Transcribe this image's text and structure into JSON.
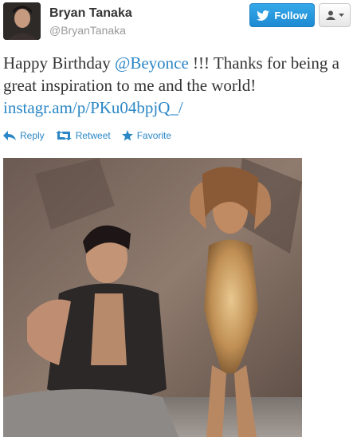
{
  "author": {
    "name": "Bryan Tanaka",
    "handle": "@BryanTanaka"
  },
  "buttons": {
    "follow_label": "Follow"
  },
  "tweet": {
    "text_before": "Happy Birthday ",
    "mention": "@Beyonce",
    "text_middle": " !!! Thanks for being a great inspiration to me and the world! ",
    "link": "instagr.am/p/PKu04bpjQ_/"
  },
  "actions": {
    "reply_label": "Reply",
    "retweet_label": "Retweet",
    "favorite_label": "Favorite"
  },
  "icons": {
    "follow": "twitter-bird-icon",
    "user_menu": "user-icon",
    "reply": "reply-arrow-icon",
    "retweet": "retweet-icon",
    "favorite": "star-icon"
  },
  "colors": {
    "link": "#2b87c6",
    "follow_button": "#2a9de1",
    "handle": "#999999"
  }
}
